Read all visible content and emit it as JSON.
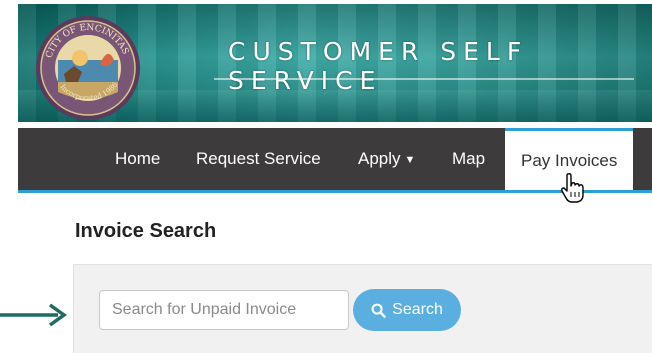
{
  "banner": {
    "title": "CUSTOMER SELF SERVICE",
    "seal_text_top": "CITY OF ENCINITAS",
    "seal_text_bottom": "Incorporated 1986"
  },
  "nav": {
    "items": [
      {
        "label": "Home"
      },
      {
        "label": "Request Service"
      },
      {
        "label": "Apply",
        "has_dropdown": true
      },
      {
        "label": "Map"
      },
      {
        "label": "Pay Invoices",
        "active": true
      }
    ]
  },
  "invoice_search": {
    "heading": "Invoice Search",
    "input_value": "",
    "placeholder": "Search for Unpaid Invoice",
    "button_label": "Search",
    "button_icon": "search-icon"
  },
  "colors": {
    "nav_bg": "#3d3b3c",
    "nav_accent": "#2c9fd6",
    "button_bg": "#5aaee0",
    "arrow": "#1f6b63",
    "banner_teal": "#1e8f8a"
  }
}
